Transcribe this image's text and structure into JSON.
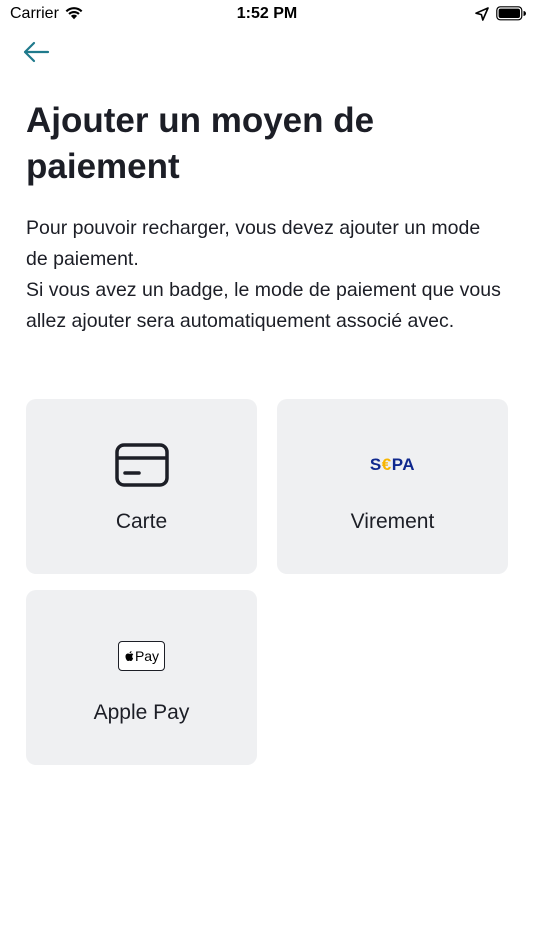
{
  "status_bar": {
    "carrier": "Carrier",
    "time": "1:52 PM"
  },
  "header": {
    "back_icon": "arrow-left-icon",
    "title": "Ajouter un moyen de paiement"
  },
  "description": {
    "line1": "Pour pouvoir recharger, vous devez ajouter un mode de paiement.",
    "line2": "Si vous avez un badge, le mode de paiement que vous allez ajouter sera automatiquement associé avec."
  },
  "payment_methods": [
    {
      "label": "Carte",
      "icon": "credit-card-icon"
    },
    {
      "label": "Virement",
      "icon": "sepa-logo",
      "logo_main": "S",
      "logo_euro": "€",
      "logo_tail": "PA"
    },
    {
      "label": "Apple Pay",
      "icon": "apple-pay-icon",
      "badge_text": "Pay"
    }
  ],
  "colors": {
    "accent": "#1f7a8c",
    "card_background": "#eff0f2",
    "text": "#1c1e26",
    "sepa_blue": "#10298e",
    "sepa_yellow": "#f7b500"
  }
}
